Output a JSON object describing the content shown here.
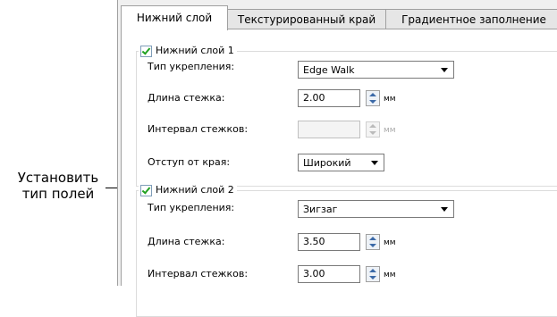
{
  "annotation": {
    "line1": "Установить",
    "line2": "тип полей"
  },
  "tabs": [
    {
      "label": "Нижний слой",
      "active": true
    },
    {
      "label": "Текстурированный край",
      "active": false
    },
    {
      "label": "Градиентное заполнение",
      "active": false
    }
  ],
  "layer1": {
    "title": "Нижний слой 1",
    "checked": true,
    "type_label": "Тип укрепления:",
    "type_value": "Edge Walk",
    "stitch_length_label": "Длина стежка:",
    "stitch_length_value": "2.00",
    "stitch_interval_label": "Интервал стежков:",
    "stitch_interval_value": "",
    "edge_offset_label": "Отступ от края:",
    "edge_offset_value": "Широкий",
    "unit": "мм"
  },
  "layer2": {
    "title": "Нижний слой 2",
    "checked": true,
    "type_label": "Тип укрепления:",
    "type_value": "Зигзаг",
    "stitch_length_label": "Длина стежка:",
    "stitch_length_value": "3.50",
    "stitch_interval_label": "Интервал стежков:",
    "stitch_interval_value": "3.00",
    "unit": "мм"
  }
}
